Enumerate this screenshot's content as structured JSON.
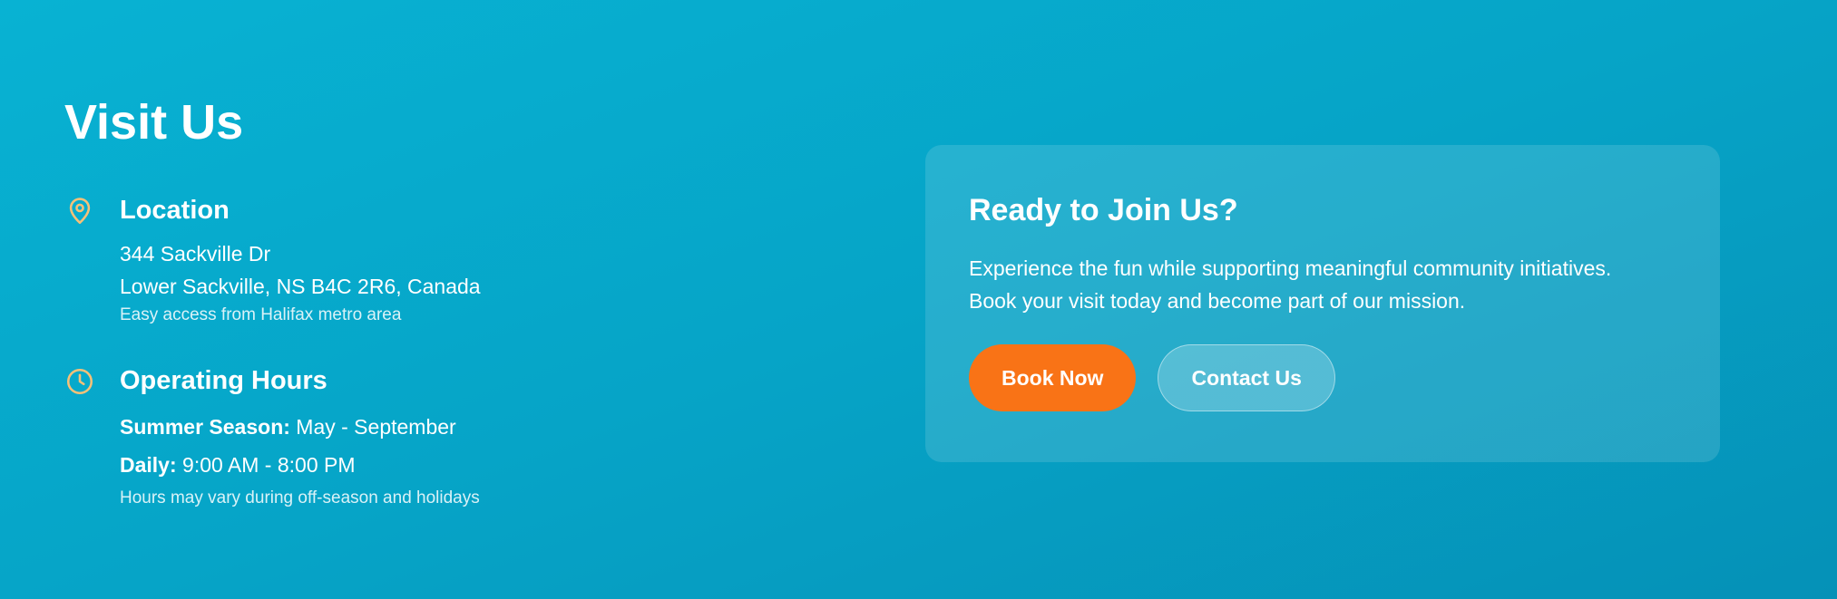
{
  "visit": {
    "title": "Visit Us",
    "location": {
      "heading": "Location",
      "address_line1": "344 Sackville Dr",
      "address_line2": "Lower Sackville, NS B4C 2R6, Canada",
      "note": "Easy access from Halifax metro area",
      "icon": "map-pin-icon"
    },
    "hours": {
      "heading": "Operating Hours",
      "season_label": "Summer Season:",
      "season_value": "May - September",
      "daily_label": "Daily:",
      "daily_value": "9:00 AM - 8:00 PM",
      "note": "Hours may vary during off-season and holidays",
      "icon": "clock-icon"
    }
  },
  "cta": {
    "title": "Ready to Join Us?",
    "text_line1": "Experience the fun while supporting meaningful community initiatives.",
    "text_line2": "Book your visit today and become part of our mission.",
    "primary_button": "Book Now",
    "secondary_button": "Contact Us"
  },
  "colors": {
    "background": "#06a4c7",
    "accent_icon": "#f6c178",
    "primary_button": "#f97316",
    "text": "#ffffff"
  }
}
